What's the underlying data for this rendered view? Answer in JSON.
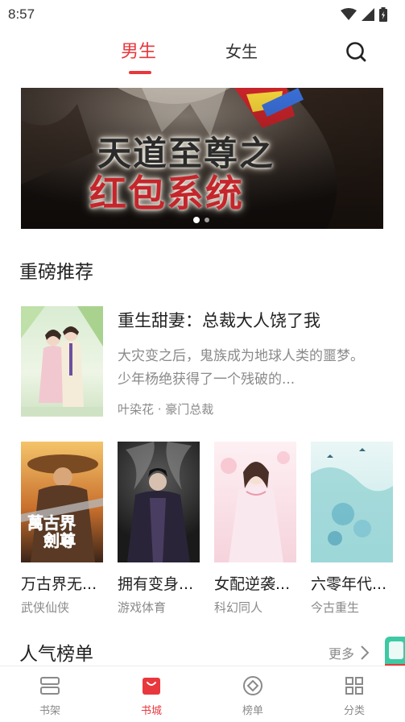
{
  "status_bar": {
    "time": "8:57"
  },
  "top_tabs": {
    "male": "男生",
    "female": "女生"
  },
  "banner": {
    "title_line1": "天道至尊之",
    "title_line2": "红包系统"
  },
  "featured_section": {
    "title": "重磅推荐",
    "book": {
      "name": "重生甜妻：总裁大人饶了我",
      "description": "大灾变之后，鬼族成为地球人类的噩梦。少年杨绝获得了一个残破的...",
      "meta": "叶染花 · 豪门总裁"
    }
  },
  "books": [
    {
      "name": "万古界无...",
      "category": "武侠仙侠"
    },
    {
      "name": "拥有变身...",
      "category": "游戏体育"
    },
    {
      "name": "女配逆袭...",
      "category": "科幻同人"
    },
    {
      "name": "六零年代...",
      "category": "今古重生"
    }
  ],
  "popular_section": {
    "title": "人气榜单",
    "more": "更多"
  },
  "bottom_nav": {
    "shelf": "书架",
    "store": "书城",
    "rank": "榜单",
    "category": "分类"
  },
  "colors": {
    "accent": "#e8383d",
    "muted": "#8a8a8a"
  }
}
